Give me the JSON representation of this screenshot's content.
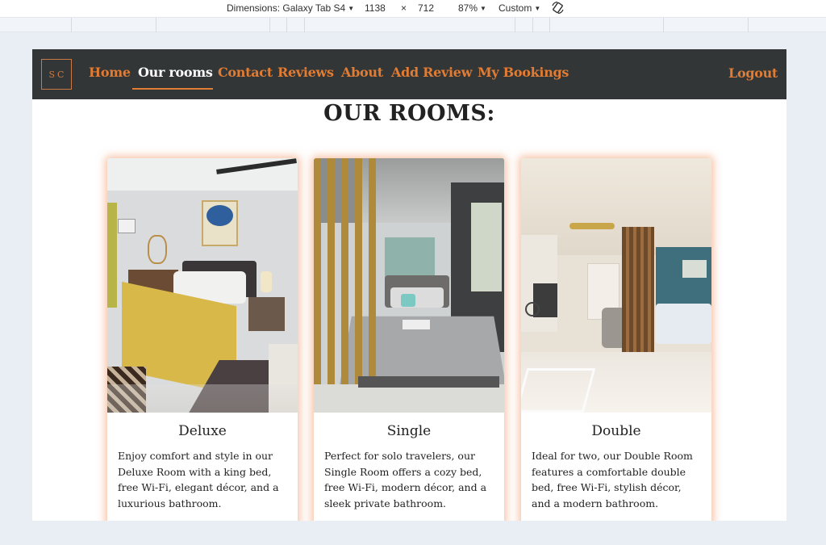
{
  "devtools": {
    "dimensions_label": "Dimensions: Galaxy Tab S4",
    "width": "1138",
    "times": "×",
    "height": "712",
    "zoom": "87%",
    "throttle": "Custom"
  },
  "nav": {
    "logo": "SC",
    "links": [
      "Home",
      "Our rooms",
      "Contact",
      "Reviews",
      "About",
      "Add Review",
      "My Bookings"
    ],
    "active": "Our rooms",
    "logout": "Logout"
  },
  "page": {
    "title": "OUR ROOMS:"
  },
  "rooms": [
    {
      "name": "Deluxe",
      "description": "Enjoy comfort and style in our Deluxe Room with a king bed, free Wi-Fi, elegant décor, and a luxurious bathroom."
    },
    {
      "name": "Single",
      "description": "Perfect for solo travelers, our Single Room offers a cozy bed, free Wi-Fi, modern décor, and a sleek private bathroom."
    },
    {
      "name": "Double",
      "description": "Ideal for two, our Double Room features a comfortable double bed, free Wi-Fi, stylish décor, and a modern bathroom."
    }
  ],
  "colors": {
    "accent": "#e07c33",
    "navbar": "#333637",
    "card_glow": "#f09664"
  },
  "icons": {
    "rotate": "rotate-icon"
  }
}
